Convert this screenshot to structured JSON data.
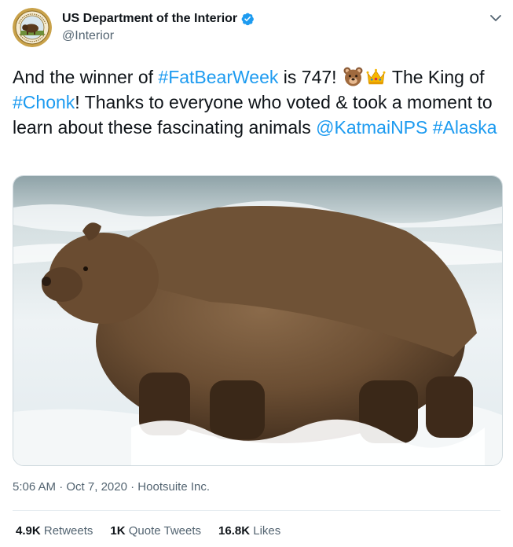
{
  "author": {
    "display_name": "US Department of the Interior",
    "handle": "@Interior",
    "verified": true
  },
  "tweet": {
    "segments": [
      {
        "text": "And the winner of ",
        "type": "text"
      },
      {
        "text": "#FatBearWeek",
        "type": "link"
      },
      {
        "text": " is 747! ",
        "type": "text"
      },
      {
        "emoji": "bear-face-emoji",
        "type": "emoji"
      },
      {
        "emoji": "crown-emoji",
        "type": "emoji"
      },
      {
        "text": " The King of ",
        "type": "text"
      },
      {
        "text": "#Chonk",
        "type": "link"
      },
      {
        "text": "! Thanks to everyone who voted & took a moment to learn about these fascinating animals ",
        "type": "text"
      },
      {
        "text": "@KatmaiNPS",
        "type": "link"
      },
      {
        "text": " ",
        "type": "text"
      },
      {
        "text": "#Alaska",
        "type": "link"
      }
    ]
  },
  "media": {
    "subject": "brown bear standing in rushing white water"
  },
  "meta": {
    "time": "5:06 AM",
    "date": "Oct 7, 2020",
    "source": "Hootsuite Inc.",
    "separator": " · "
  },
  "stats": {
    "retweets_count": "4.9K",
    "retweets_label": "Retweets",
    "quotes_count": "1K",
    "quotes_label": "Quote Tweets",
    "likes_count": "16.8K",
    "likes_label": "Likes"
  },
  "colors": {
    "link": "#1d9bf0",
    "text": "#0f1419",
    "muted": "#536471",
    "verified": "#1d9bf0"
  }
}
